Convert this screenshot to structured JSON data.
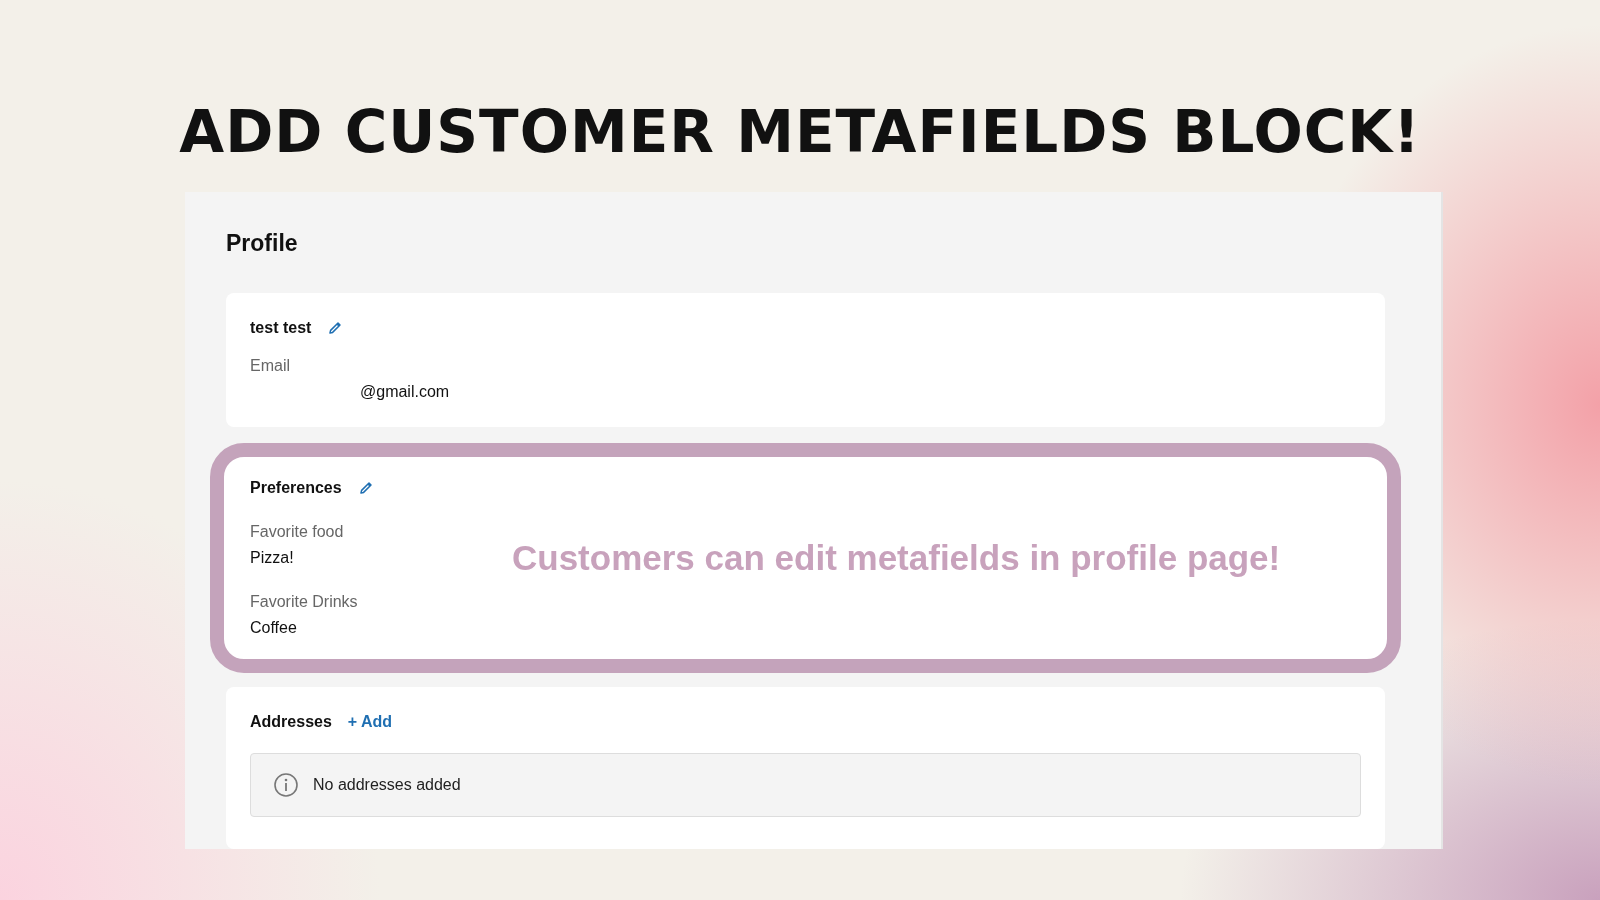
{
  "headline": "ADD CUSTOMER METAFIELDS BLOCK!",
  "page": {
    "title": "Profile"
  },
  "profile_card": {
    "name": "test test",
    "email_label": "Email",
    "email_value": "@gmail.com"
  },
  "preferences_card": {
    "title": "Preferences",
    "fields": [
      {
        "label": "Favorite food",
        "value": "Pizza!"
      },
      {
        "label": "Favorite Drinks",
        "value": "Coffee"
      }
    ],
    "callout": "Customers can edit metafields in profile page!"
  },
  "addresses_card": {
    "title": "Addresses",
    "add_link": "+ Add",
    "empty_message": "No addresses added"
  }
}
